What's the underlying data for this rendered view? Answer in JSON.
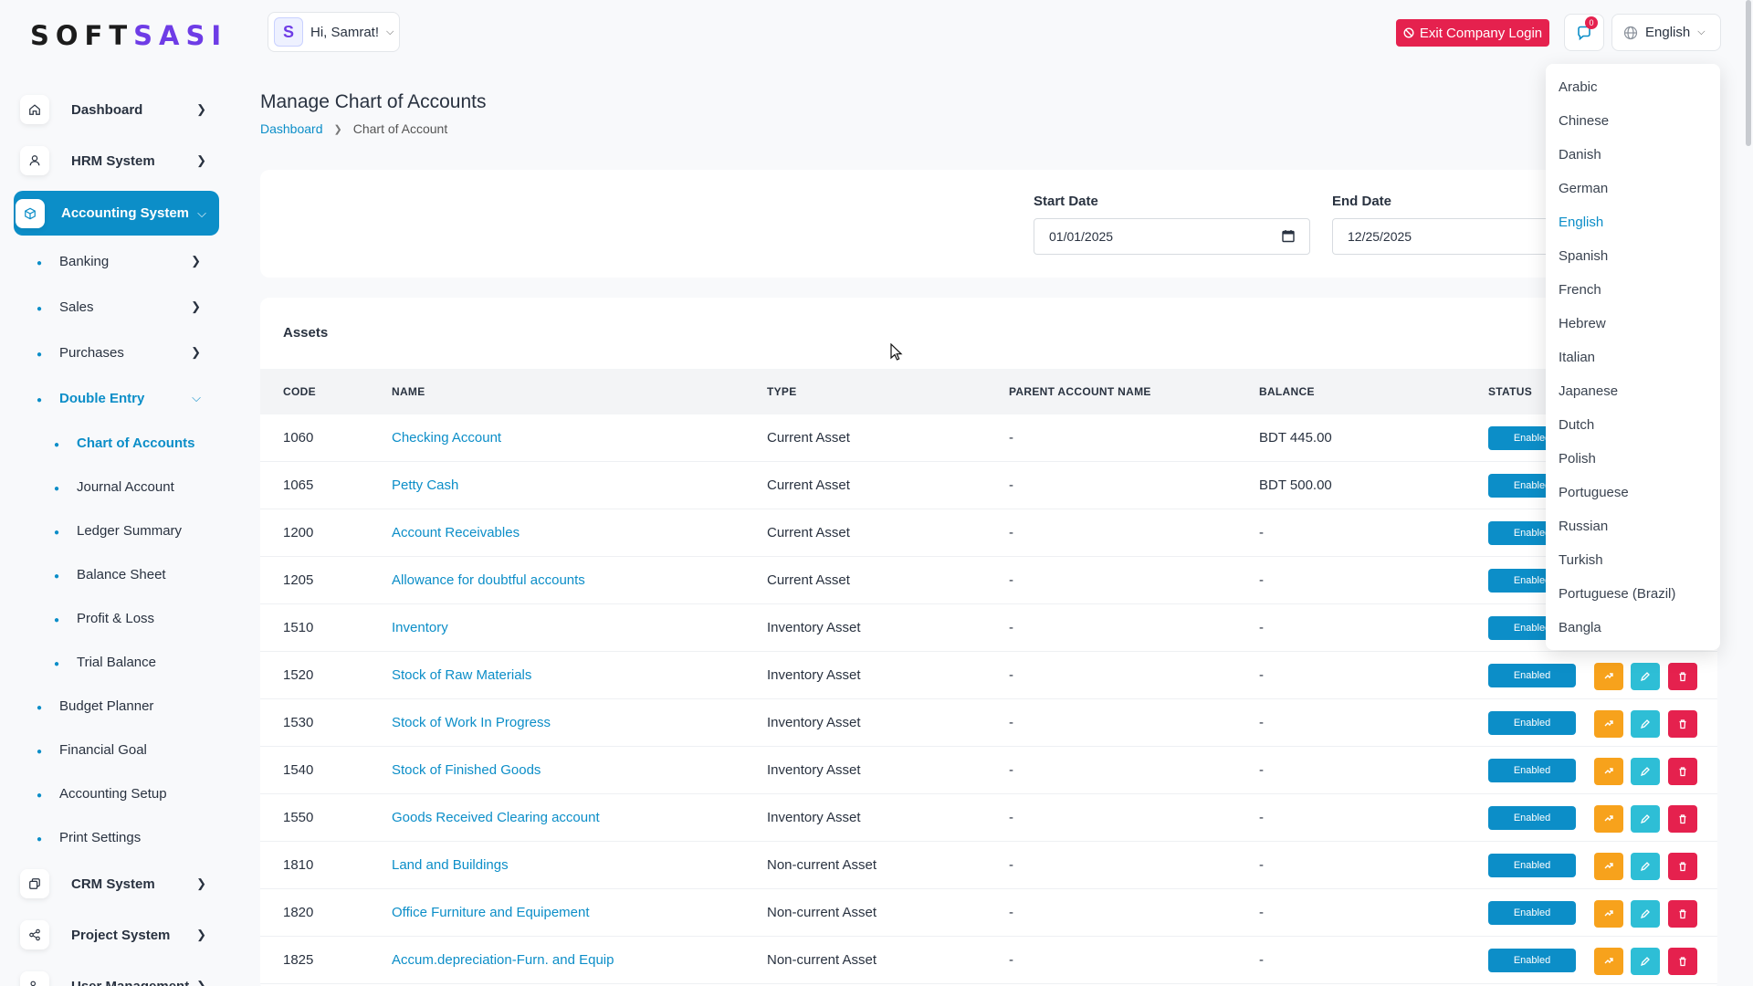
{
  "brand": {
    "part1": "SOFT",
    "part2": "SASI"
  },
  "header": {
    "greeting": "Hi, Samrat!",
    "exit_label": "Exit Company Login",
    "notification_count": "0",
    "language_current": "English"
  },
  "sidebar": {
    "main": [
      {
        "label": "Dashboard",
        "icon": "home-icon"
      },
      {
        "label": "HRM System",
        "icon": "user-icon"
      },
      {
        "label": "Accounting System",
        "icon": "box-icon"
      },
      {
        "label": "CRM System",
        "icon": "layers-icon"
      },
      {
        "label": "Project System",
        "icon": "share-icon"
      },
      {
        "label": "User Management",
        "icon": "users-icon"
      }
    ],
    "accounting_sub": [
      "Banking",
      "Sales",
      "Purchases",
      "Double Entry",
      "Budget Planner",
      "Financial Goal",
      "Accounting Setup",
      "Print Settings"
    ],
    "double_entry_sub": [
      "Chart of Accounts",
      "Journal Account",
      "Ledger Summary",
      "Balance Sheet",
      "Profit & Loss",
      "Trial Balance"
    ]
  },
  "page": {
    "title": "Manage Chart of Accounts",
    "breadcrumb": [
      "Dashboard",
      "Chart of Account"
    ]
  },
  "filters": {
    "start_label": "Start Date",
    "start_value": "01/01/2025",
    "end_label": "End Date",
    "end_value": "12/25/2025"
  },
  "table": {
    "section": "Assets",
    "headers": [
      "CODE",
      "NAME",
      "TYPE",
      "PARENT ACCOUNT NAME",
      "BALANCE",
      "STATUS"
    ],
    "rows": [
      {
        "code": "1060",
        "name": "Checking Account",
        "type": "Current Asset",
        "parent": "-",
        "balance": "BDT 445.00",
        "status": "Enabled"
      },
      {
        "code": "1065",
        "name": "Petty Cash",
        "type": "Current Asset",
        "parent": "-",
        "balance": "BDT 500.00",
        "status": "Enabled"
      },
      {
        "code": "1200",
        "name": "Account Receivables",
        "type": "Current Asset",
        "parent": "-",
        "balance": "-",
        "status": "Enabled"
      },
      {
        "code": "1205",
        "name": "Allowance for doubtful accounts",
        "type": "Current Asset",
        "parent": "-",
        "balance": "-",
        "status": "Enabled"
      },
      {
        "code": "1510",
        "name": "Inventory",
        "type": "Inventory Asset",
        "parent": "-",
        "balance": "-",
        "status": "Enabled"
      },
      {
        "code": "1520",
        "name": "Stock of Raw Materials",
        "type": "Inventory Asset",
        "parent": "-",
        "balance": "-",
        "status": "Enabled"
      },
      {
        "code": "1530",
        "name": "Stock of Work In Progress",
        "type": "Inventory Asset",
        "parent": "-",
        "balance": "-",
        "status": "Enabled"
      },
      {
        "code": "1540",
        "name": "Stock of Finished Goods",
        "type": "Inventory Asset",
        "parent": "-",
        "balance": "-",
        "status": "Enabled"
      },
      {
        "code": "1550",
        "name": "Goods Received Clearing account",
        "type": "Inventory Asset",
        "parent": "-",
        "balance": "-",
        "status": "Enabled"
      },
      {
        "code": "1810",
        "name": "Land and Buildings",
        "type": "Non-current Asset",
        "parent": "-",
        "balance": "-",
        "status": "Enabled"
      },
      {
        "code": "1820",
        "name": "Office Furniture and Equipement",
        "type": "Non-current Asset",
        "parent": "-",
        "balance": "-",
        "status": "Enabled"
      },
      {
        "code": "1825",
        "name": "Accum.depreciation-Furn. and Equip",
        "type": "Non-current Asset",
        "parent": "-",
        "balance": "-",
        "status": "Enabled"
      }
    ]
  },
  "languages": [
    "Arabic",
    "Chinese",
    "Danish",
    "German",
    "English",
    "Spanish",
    "French",
    "Hebrew",
    "Italian",
    "Japanese",
    "Dutch",
    "Polish",
    "Portuguese",
    "Russian",
    "Turkish",
    "Portuguese (Brazil)",
    "Bangla"
  ],
  "colors": {
    "accent": "#0c8ec8",
    "danger": "#e5214e",
    "warning": "#f7a21c",
    "info": "#2ebed6",
    "brand_purple": "#6e3ce6"
  }
}
